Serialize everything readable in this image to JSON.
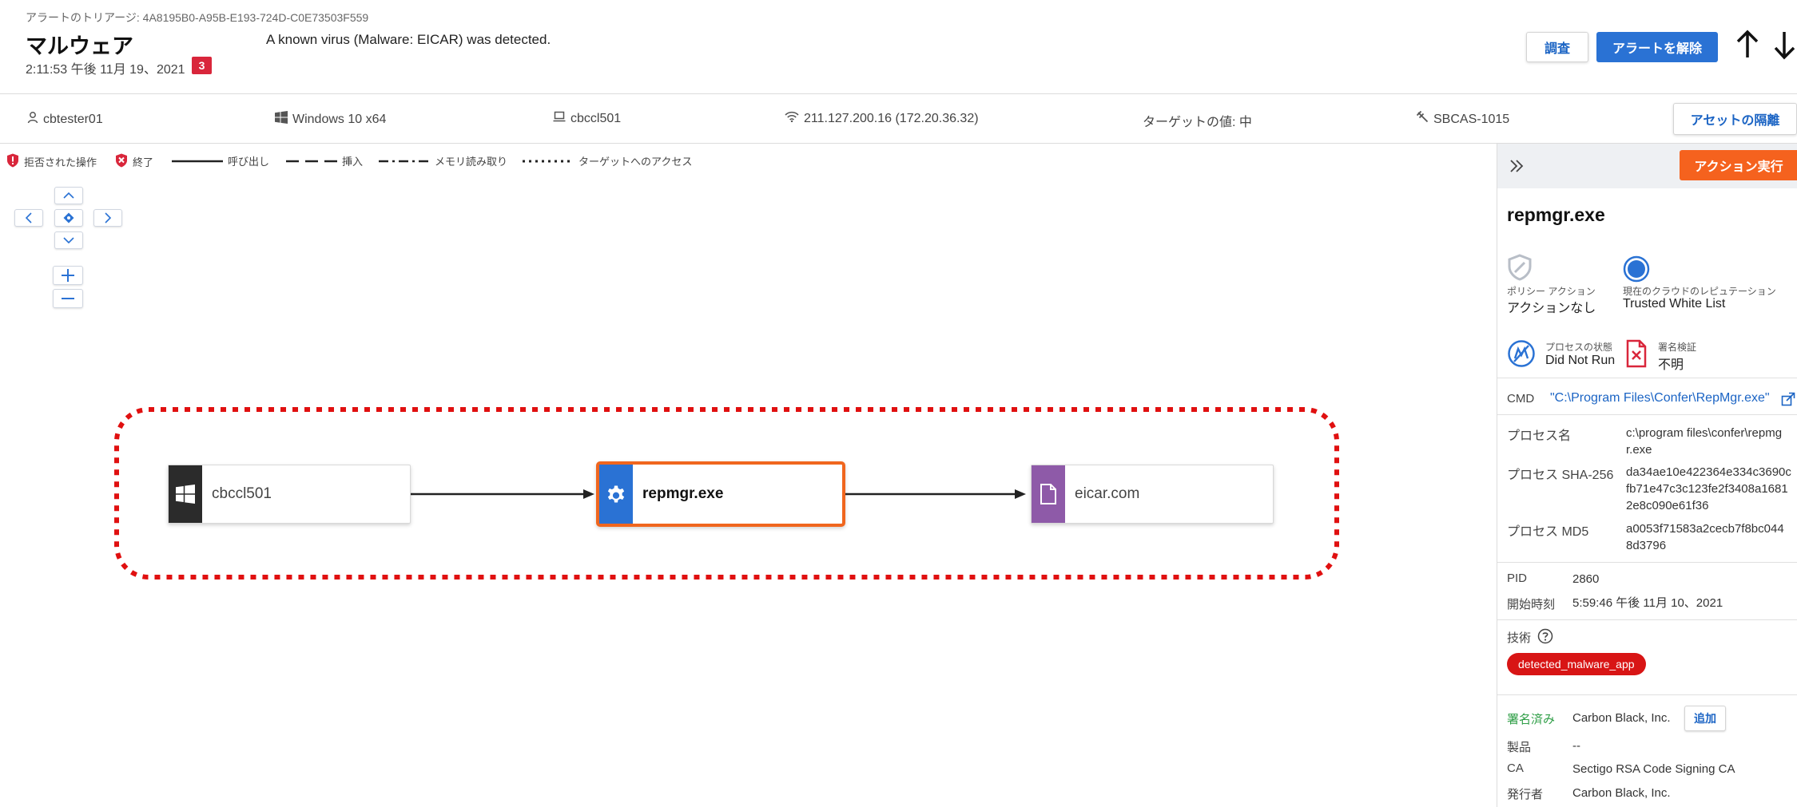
{
  "header": {
    "alert_id": "アラートのトリアージ: 4A8195B0-A95B-E193-724D-C0E73503F559",
    "title": "マルウェア",
    "timestamp": "2:11:53 午後 11月 19、2021",
    "severity": "3",
    "reason": "A known virus (Malware: EICAR) was detected.",
    "investigate_label": "調査",
    "dismiss_label": "アラートを解除",
    "prev_icon": "arrow-up-icon",
    "next_icon": "arrow-down-icon"
  },
  "infobar": {
    "user": "cbtester01",
    "os": "Windows 10 x64",
    "device": "cbccl501",
    "ip": "211.127.200.16 (172.20.36.32)",
    "target_value": "ターゲットの値: 中",
    "policy": "SBCAS-1015",
    "isolate_label": "アセットの隔離"
  },
  "legend": {
    "denied": "拒否された操作",
    "terminated": "終了",
    "invoke": "呼び出し",
    "inject": "挿入",
    "memory_read": "メモリ読み取り",
    "target_access": "ターゲットへのアクセス"
  },
  "graph": {
    "nodes": [
      {
        "label": "cbccl501",
        "type": "device",
        "color": "#2b2b2b",
        "icon": "windows-icon"
      },
      {
        "label": "repmgr.exe",
        "type": "process",
        "color": "#2a72d4",
        "icon": "gear-icon",
        "selected": true
      },
      {
        "label": "eicar.com",
        "type": "file",
        "color": "#8e5aa8",
        "icon": "file-icon"
      }
    ],
    "highlight_color": "#e01010"
  },
  "panel": {
    "action_label": "アクション実行",
    "process_name": "repmgr.exe",
    "policy_action_label": "ポリシー アクション",
    "policy_action_value": "アクションなし",
    "reputation_label": "現在のクラウドのレピュテーション",
    "reputation_value": "Trusted White List",
    "process_state_label": "プロセスの状態",
    "process_state_value": "Did Not Run",
    "signature_label": "署名検証",
    "signature_value": "不明",
    "cmd_label": "CMD",
    "cmd_value": "\"C:\\Program Files\\Confer\\RepMgr.exe\"",
    "process_name_label": "プロセス名",
    "process_name_value": "c:\\program files\\confer\\repmg\nr.exe",
    "sha256_label": "プロセス SHA-256",
    "sha256_value": "da34ae10e422364e334c3690c\nfb71e47c3c123fe2f3408a1681\n2e8c090e61f36",
    "md5_label": "プロセス MD5",
    "md5_value": "a0053f71583a2cecb7f8bc044\n8d3796",
    "pid_label": "PID",
    "pid_value": "2860",
    "start_label": "開始時刻",
    "start_value": "5:59:46 午後 11月 10、2021",
    "technique_label": "技術",
    "technique_tag": "detected_malware_app",
    "signed_label": "署名済み",
    "signed_value": "Carbon Black, Inc.",
    "add_label": "追加",
    "product_label": "製品",
    "product_value": "--",
    "ca_label": "CA",
    "ca_value": "Sectigo RSA Code Signing CA",
    "publisher_label": "発行者",
    "publisher_value": "Carbon Black, Inc."
  }
}
